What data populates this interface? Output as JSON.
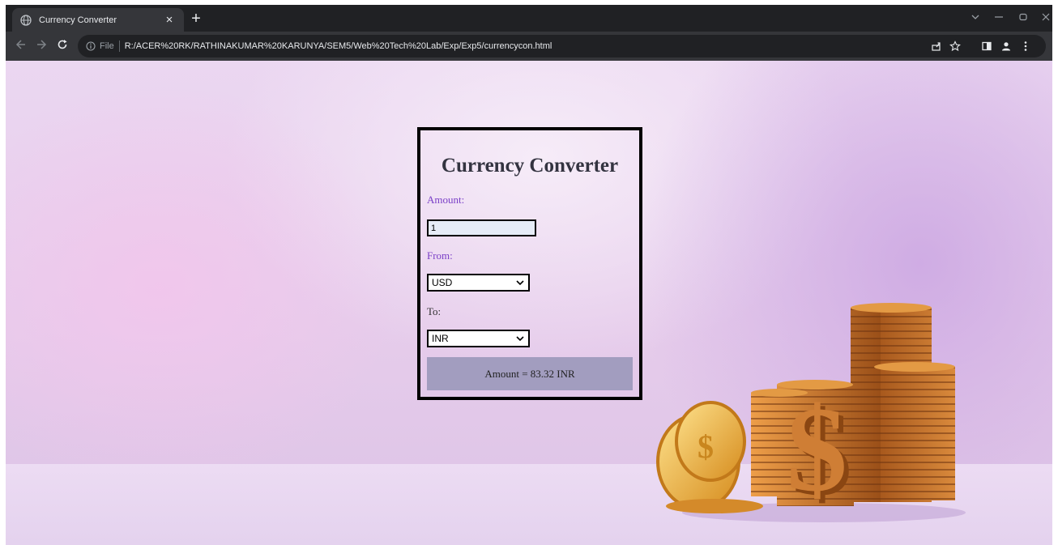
{
  "tab": {
    "title": "Currency Converter",
    "close": "×",
    "new_tab": "+"
  },
  "toolbar": {
    "file_label": "File",
    "url": "R:/ACER%20RK/RATHINAKUMAR%20KARUNYA/SEM5/Web%20Tech%20Lab/Exp/Exp5/currencycon.html"
  },
  "converter": {
    "title": "Currency Converter",
    "amount_label": "Amount:",
    "amount_value": "1",
    "from_label": "From:",
    "from_value": "USD",
    "to_label": "To:",
    "to_value": "INR",
    "result": "Amount = 83.32 INR"
  },
  "colors": {
    "label_purple": "#7a3fc7",
    "result_bg": "#a29dbf",
    "chrome_dark": "#202124",
    "chrome_toolbar": "#35363a"
  },
  "icons": [
    "globe-icon",
    "back-icon",
    "forward-icon",
    "reload-icon",
    "info-icon",
    "share-icon",
    "star-icon",
    "sidepanel-icon",
    "profile-icon",
    "menu-icon",
    "chevron-down-icon"
  ]
}
